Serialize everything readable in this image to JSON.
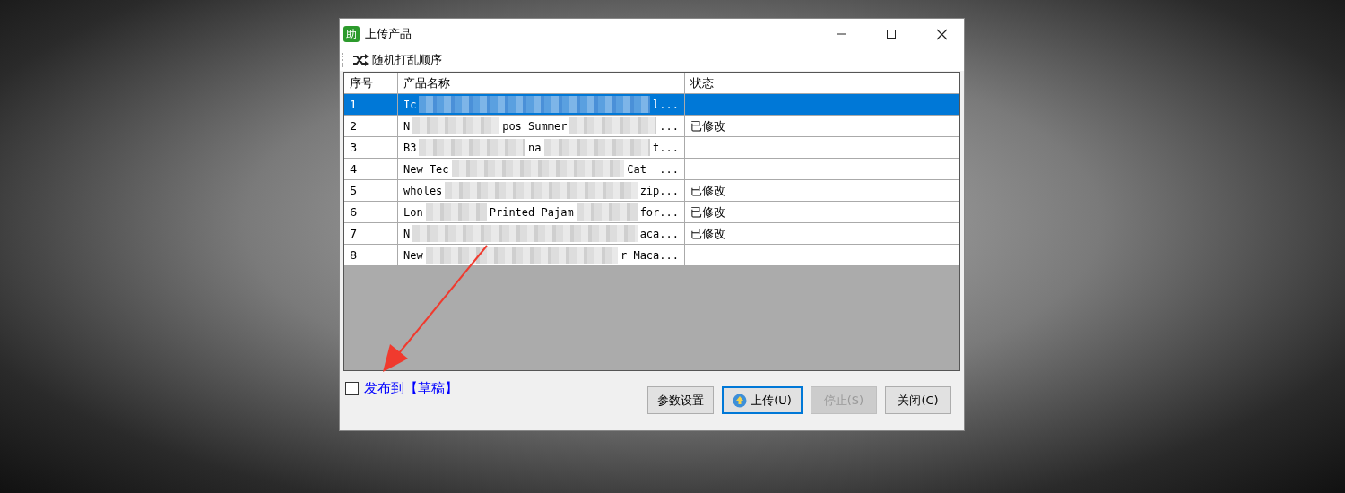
{
  "window": {
    "title": "上传产品",
    "app_icon_glyph": "助"
  },
  "toolbar": {
    "shuffle_label": "随机打乱顺序"
  },
  "table": {
    "columns": [
      "序号",
      "产品名称",
      "状态"
    ],
    "rows": [
      {
        "index": "1",
        "name_fragments": [
          "Ic",
          "l..."
        ],
        "selected": true
      },
      {
        "index": "2",
        "name_fragments": [
          "N",
          "pos Summer",
          "..."
        ],
        "status": "已修改",
        "selected": false
      },
      {
        "index": "3",
        "name_fragments": [
          "B3",
          "na",
          "t..."
        ],
        "selected": false
      },
      {
        "index": "4",
        "name_fragments": [
          "New Tec",
          "Cat  ..."
        ],
        "selected": false
      },
      {
        "index": "5",
        "name_fragments": [
          "wholes",
          "zip..."
        ],
        "status": "已修改",
        "selected": false
      },
      {
        "index": "6",
        "name_fragments": [
          "Lon",
          "Printed Pajam",
          "for..."
        ],
        "status": "已修改",
        "selected": false
      },
      {
        "index": "7",
        "name_fragments": [
          "N",
          "aca..."
        ],
        "status": "已修改",
        "selected": false
      },
      {
        "index": "8",
        "name_fragments": [
          "New",
          "r Maca..."
        ],
        "selected": false
      }
    ]
  },
  "publish_option": {
    "label": "发布到【草稿】",
    "checked": false
  },
  "buttons": [
    {
      "label": "参数设置",
      "kind": "plain",
      "disabled": false,
      "focused": false
    },
    {
      "label": "上传(U)",
      "kind": "upload",
      "disabled": false,
      "focused": true
    },
    {
      "label": "停止(S)",
      "kind": "plain",
      "disabled": true,
      "focused": false
    },
    {
      "label": "关闭(C)",
      "kind": "plain",
      "disabled": false,
      "focused": false
    }
  ]
}
